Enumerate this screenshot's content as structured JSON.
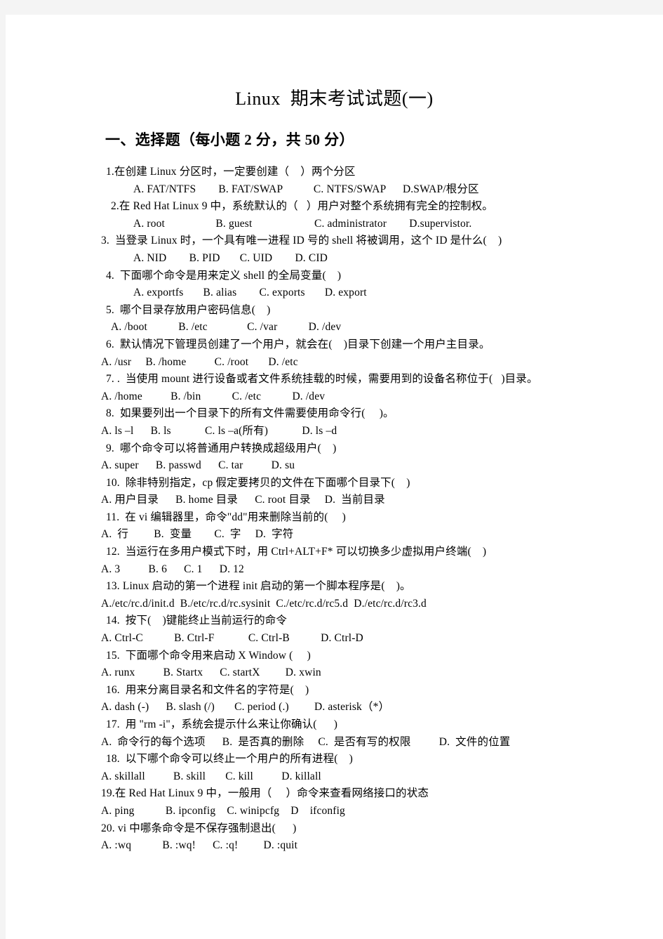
{
  "document": {
    "title": "Linux  期末考试试题(一)",
    "section_heading": "一、选择题（每小题 2 分，共 50 分）"
  },
  "questions": [
    {
      "stem": "1.在创建 Linux 分区时，一定要创建（    ）两个分区",
      "stem_indent": 1,
      "options": "A. FAT/NTFS        B. FAT/SWAP           C. NTFS/SWAP      D.SWAP/根分区",
      "options_indent": 3
    },
    {
      "stem": "2.在 Red Hat Linux 9 中，系统默认的（   ）用户对整个系统拥有完全的控制权。",
      "stem_indent": 2,
      "options": "A. root                  B. guest                      C. administrator        D.supervistor.",
      "options_indent": 3
    },
    {
      "stem": "3.  当登录 Linux 时，一个具有唯一进程 ID 号的 shell 将被调用，这个 ID 是什么(    )",
      "stem_indent": 0,
      "options": "A. NID        B. PID       C. UID        D. CID",
      "options_indent": 3
    },
    {
      "stem": "4.  下面哪个命令是用来定义 shell 的全局变量(    )",
      "stem_indent": 1,
      "options": "A. exportfs       B. alias        C. exports       D. export",
      "options_indent": 3
    },
    {
      "stem": "5.  哪个目录存放用户密码信息(    )",
      "stem_indent": 1,
      "options": "A. /boot           B. /etc              C. /var           D. /dev",
      "options_indent": 2
    },
    {
      "stem": "6.  默认情况下管理员创建了一个用户，就会在(    )目录下创建一个用户主目录。",
      "stem_indent": 1,
      "options": "A. /usr     B. /home          C. /root       D. /etc",
      "options_indent": 0
    },
    {
      "stem": "7. .  当使用 mount 进行设备或者文件系统挂载的时候，需要用到的设备名称位于(   )目录。",
      "stem_indent": 1,
      "options": "A. /home          B. /bin           C. /etc           D. /dev",
      "options_indent": 0
    },
    {
      "stem": "8.  如果要列出一个目录下的所有文件需要使用命令行(     )。",
      "stem_indent": 1,
      "options": "A. ls –l      B. ls            C. ls –a(所有)            D. ls –d",
      "options_indent": 0
    },
    {
      "stem": "9.  哪个命令可以将普通用户转换成超级用户(    )",
      "stem_indent": 1,
      "options": "A. super      B. passwd      C. tar          D. su",
      "options_indent": 0
    },
    {
      "stem": "10.  除非特别指定，cp 假定要拷贝的文件在下面哪个目录下(    )",
      "stem_indent": 1,
      "options": "A. 用户目录      B. home 目录      C. root 目录     D.  当前目录",
      "options_indent": 0
    },
    {
      "stem": "11.  在 vi 编辑器里，命令\"dd\"用来删除当前的(     )",
      "stem_indent": 1,
      "options": "A.  行         B.  变量        C.  字     D.  字符",
      "options_indent": 0
    },
    {
      "stem": "12.  当运行在多用户模式下时，用 Ctrl+ALT+F* 可以切换多少虚拟用户终端(    )",
      "stem_indent": 1,
      "options": "A. 3          B. 6      C. 1      D. 12",
      "options_indent": 0
    },
    {
      "stem": "13. Linux 启动的第一个进程 init 启动的第一个脚本程序是(    )。",
      "stem_indent": 1,
      "options": "A./etc/rc.d/init.d  B./etc/rc.d/rc.sysinit  C./etc/rc.d/rc5.d  D./etc/rc.d/rc3.d",
      "options_indent": 0
    },
    {
      "stem": "14.  按下(    )键能终止当前运行的命令",
      "stem_indent": 1,
      "options": "A. Ctrl-C           B. Ctrl-F            C. Ctrl-B           D. Ctrl-D",
      "options_indent": 0
    },
    {
      "stem": "15.  下面哪个命令用来启动 X Window (     )",
      "stem_indent": 1,
      "options": "A. runx          B. Startx      C. startX         D. xwin",
      "options_indent": 0
    },
    {
      "stem": "16.  用来分离目录名和文件名的字符是(    )",
      "stem_indent": 1,
      "options": "A. dash (-)      B. slash (/)       C. period (.)         D. asterisk（*）",
      "options_indent": 0
    },
    {
      "stem": "17.  用 \"rm -i\"，系统会提示什么来让你确认(      )",
      "stem_indent": 1,
      "options": "A.  命令行的每个选项      B.  是否真的删除     C.  是否有写的权限          D.  文件的位置",
      "options_indent": 0
    },
    {
      "stem": "18.  以下哪个命令可以终止一个用户的所有进程(    )",
      "stem_indent": 1,
      "options": "A. skillall          B. skill       C. kill          D. killall",
      "options_indent": 0
    },
    {
      "stem": "19.在 Red Hat Linux 9 中，一般用（     ）命令来查看网络接口的状态",
      "stem_indent": 0,
      "options": "A. ping           B. ipconfig    C. winipcfg    D    ifconfig",
      "options_indent": 0
    },
    {
      "stem": "20. vi 中哪条命令是不保存强制退出(      )",
      "stem_indent": 0,
      "options": "A. :wq           B. :wq!      C. :q!         D. :quit",
      "options_indent": 0
    }
  ]
}
